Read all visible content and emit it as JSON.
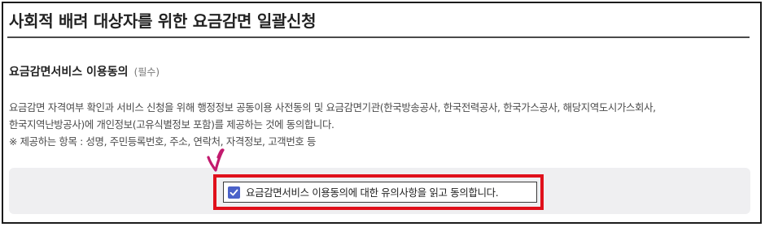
{
  "page": {
    "title": "사회적 배려 대상자를 위한 요금감면 일괄신청"
  },
  "consent_section": {
    "title": "요금감면서비스 이용동의",
    "required_label": "(필수)",
    "description_lines": [
      "요금감면 자격여부 확인과 서비스 신청을 위해 행정정보 공동이용 사전동의 및 요금감면기관(한국방송공사, 한국전력공사, 한국가스공사, 해당지역도시가스회사,",
      "한국지역난방공사)에 개인정보(고유식별정보 포함)를 제공하는 것에 동의합니다.",
      "※ 제공하는 항목 : 성명, 주민등록번호, 주소, 연락처, 자격정보, 고객번호 등"
    ],
    "agree_checkbox": {
      "label": "요금감면서비스 이용동의에 대한 유의사항을 읽고 동의합니다.",
      "checked": true
    }
  },
  "annotations": {
    "highlight_color": "#e0101b",
    "pointer_color": "#c21a6e",
    "pointer_icon": "handdrawn-check-mark-icon"
  },
  "colors": {
    "checkbox_fill": "#4b62c9",
    "consent_box_bg": "#efeff1"
  }
}
